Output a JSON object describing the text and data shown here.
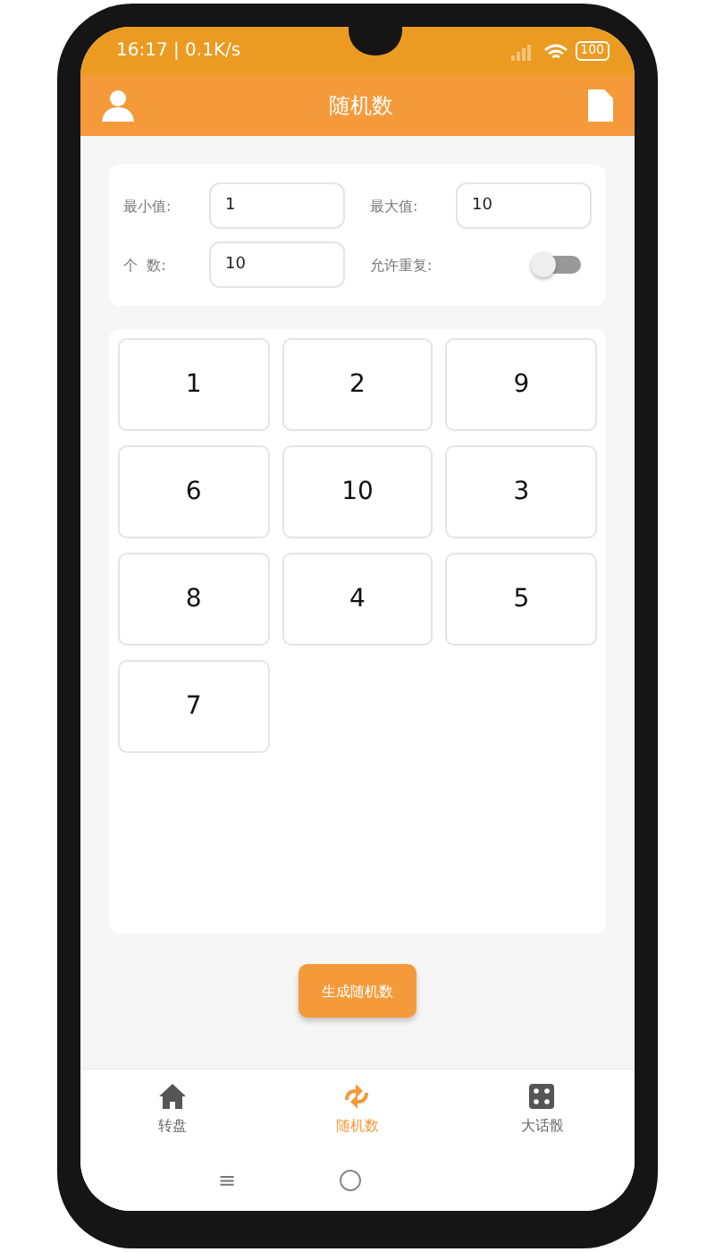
{
  "status_bar": {
    "time": "16:17 | 0.1K/s",
    "battery": "100"
  },
  "header": {
    "title": "随机数"
  },
  "form": {
    "fields": [
      {
        "label": "最小值:",
        "value": "1"
      },
      {
        "label": "最大值:",
        "value": "10"
      },
      {
        "label": "个  数:",
        "value": "10"
      }
    ],
    "toggle": {
      "label": "允许重复:",
      "on": false
    }
  },
  "numbers": [
    "1",
    "2",
    "9",
    "6",
    "10",
    "3",
    "8",
    "4",
    "5",
    "7"
  ],
  "generate_button": "生成随机数",
  "tabs": [
    {
      "kind": "home",
      "label": "转盘",
      "selected": false
    },
    {
      "kind": "shuffle",
      "label": "随机数",
      "selected": true
    },
    {
      "kind": "dice",
      "label": "大话骰",
      "selected": false
    }
  ],
  "nav_bar": {
    "menu": "≡"
  }
}
